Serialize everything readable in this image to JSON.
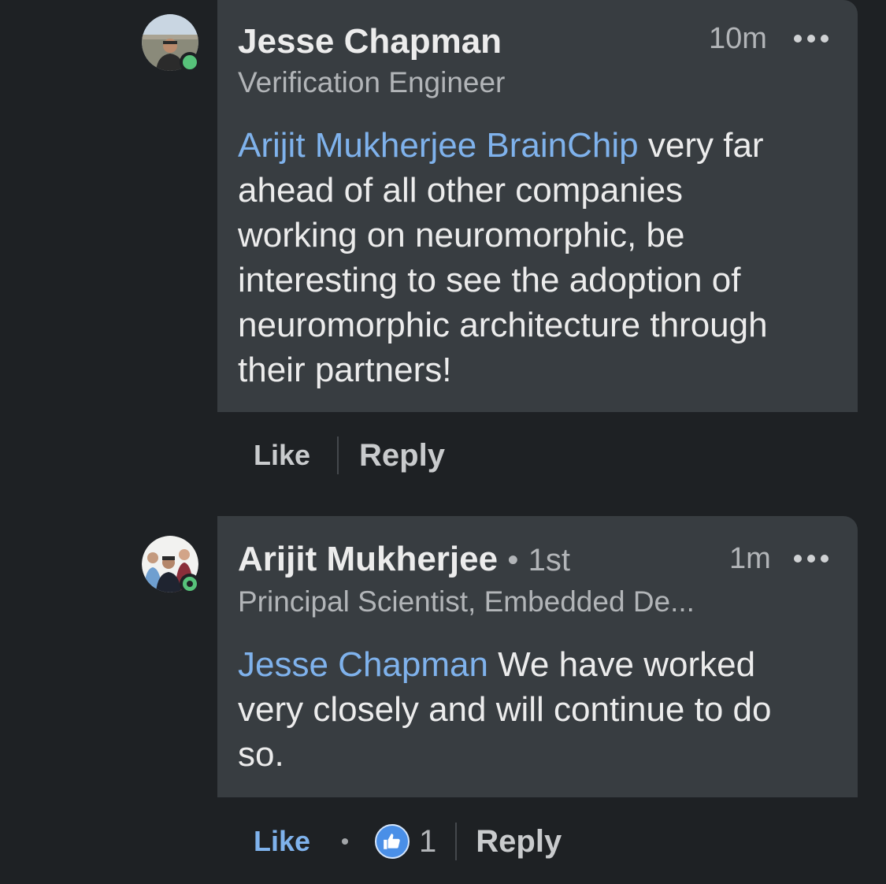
{
  "comments": [
    {
      "author": "Jesse Chapman",
      "degree": "",
      "headline": "Verification Engineer",
      "time": "10m",
      "mention": "Arijit Mukherjee BrainChip",
      "text_lines": [
        " very far",
        "ahead of all other companies",
        "working on neuromorphic, be",
        "interesting to see the adoption of",
        "neuromorphic architecture through",
        "their partners!"
      ],
      "actions": {
        "like_label": "Like",
        "reply_label": "Reply"
      },
      "presence": "online",
      "avatar_icon": "profile-photo"
    },
    {
      "author": "Arijit Mukherjee",
      "degree": "1st",
      "degree_separator": "•",
      "headline": "Principal Scientist, Embedded De...",
      "time": "1m",
      "mention": "Jesse Chapman",
      "text_lines": [
        " We have worked",
        "very closely and will continue to do",
        "so."
      ],
      "actions": {
        "like_label": "Like",
        "reply_label": "Reply",
        "reaction_icon": "thumbs-up-icon",
        "reaction_count": "1"
      },
      "presence": "recently-active",
      "avatar_icon": "group-photo"
    }
  ],
  "colors": {
    "background": "#1e2124",
    "bubble": "#383d41",
    "mention": "#7fb2ec",
    "presence_green": "#57c27a",
    "like_blue": "#4a8fe7"
  }
}
